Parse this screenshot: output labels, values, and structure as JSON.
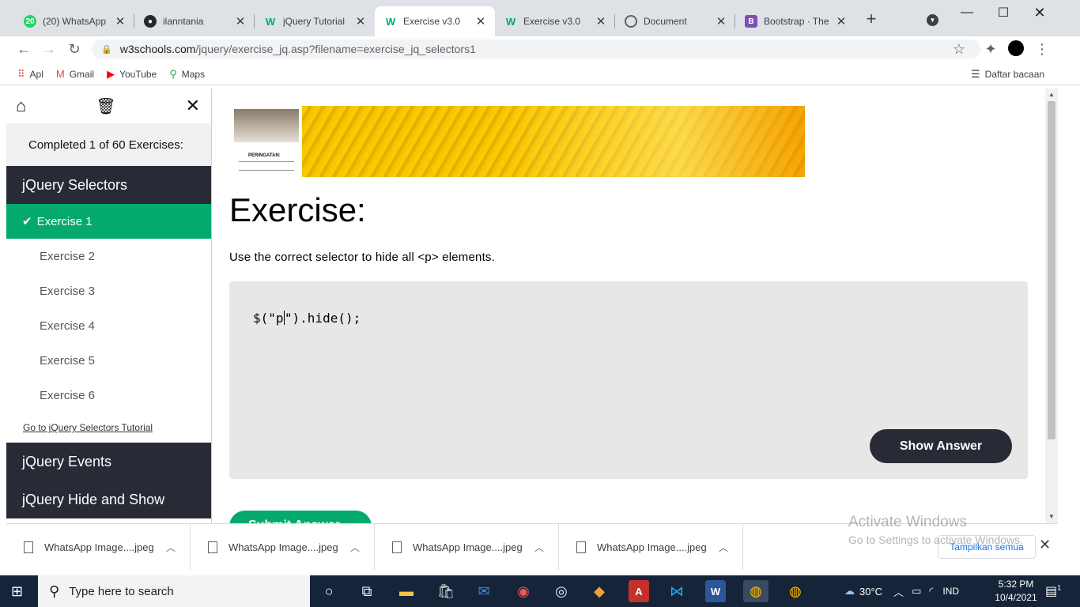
{
  "browser": {
    "tabs": [
      {
        "title": "(20) WhatsApp",
        "favicon": "whatsapp-icon",
        "badge": "20"
      },
      {
        "title": "ilanntania",
        "favicon": "github-icon"
      },
      {
        "title": "jQuery Tutorial",
        "favicon": "w3schools-icon"
      },
      {
        "title": "Exercise v3.0",
        "favicon": "w3schools-icon",
        "active": true
      },
      {
        "title": "Exercise v3.0",
        "favicon": "w3schools-icon"
      },
      {
        "title": "Document",
        "favicon": "globe-icon"
      },
      {
        "title": "Bootstrap · The",
        "favicon": "bootstrap-icon"
      }
    ],
    "url_host": "w3schools.com",
    "url_path": "/jquery/exercise_jq.asp?filename=exercise_jq_selectors1",
    "bookmarks": [
      {
        "label": "Apl",
        "icon": "apps-grid-icon"
      },
      {
        "label": "Gmail",
        "icon": "gmail-icon"
      },
      {
        "label": "YouTube",
        "icon": "youtube-icon"
      },
      {
        "label": "Maps",
        "icon": "maps-pin-icon"
      }
    ],
    "reading_list": "Daftar bacaan"
  },
  "sidebar": {
    "completed": "Completed 1 of 60 Exercises:",
    "section_active": "jQuery Selectors",
    "exercises": [
      "Exercise 1",
      "Exercise 2",
      "Exercise 3",
      "Exercise 4",
      "Exercise 5",
      "Exercise 6"
    ],
    "tutorial_link": "Go to jQuery Selectors Tutorial",
    "section_events": "jQuery Events",
    "section_hide_show": "jQuery Hide and Show"
  },
  "ad": {
    "caption": "PERINGATAN:"
  },
  "main": {
    "heading": "Exercise:",
    "instruction": "Use the correct selector to hide all <p> elements.",
    "code_prefix": "$(\"",
    "code_input": "p",
    "code_suffix": "\").hide();",
    "show_answer": "Show Answer",
    "submit": "Submit Answer »"
  },
  "downloads": {
    "items": [
      "WhatsApp Image....jpeg",
      "WhatsApp Image....jpeg",
      "WhatsApp Image....jpeg",
      "WhatsApp Image....jpeg"
    ],
    "show_all": "Tampilkan semua"
  },
  "watermark": {
    "line1": "Activate Windows",
    "line2": "Go to Settings to activate Windows."
  },
  "taskbar": {
    "search_placeholder": "Type here to search",
    "weather": "30°C",
    "language": "IND",
    "time": "5:32 PM",
    "date": "10/4/2021",
    "notification_count": "1"
  }
}
